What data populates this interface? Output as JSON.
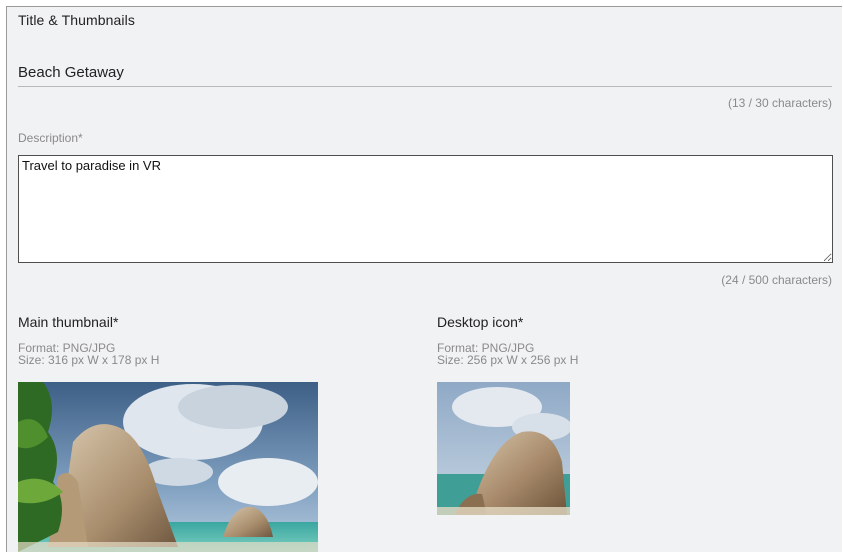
{
  "section": {
    "title": "Title & Thumbnails"
  },
  "title_field": {
    "value": "Beach Getaway",
    "counter": "(13 / 30 characters)"
  },
  "description": {
    "label": "Description*",
    "value": "Travel to paradise in VR",
    "counter": "(24 / 500 characters)"
  },
  "main_thumbnail": {
    "heading": "Main thumbnail*",
    "format": "Format: PNG/JPG",
    "size": "Size: 316 px W x 178 px H",
    "image": "beach-granite-rocks-palm"
  },
  "desktop_icon": {
    "heading": "Desktop icon*",
    "format": "Format: PNG/JPG",
    "size": "Size: 256 px W x 256 px H",
    "image": "beach-granite-rock"
  }
}
